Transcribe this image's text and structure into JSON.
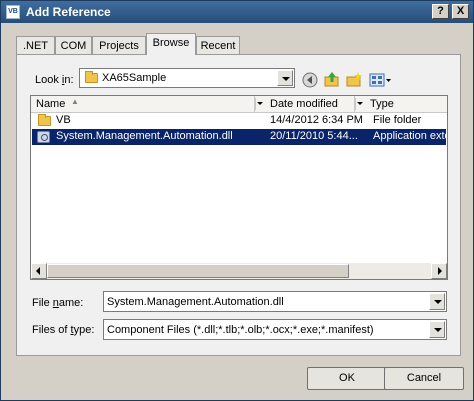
{
  "window": {
    "title": "Add Reference",
    "icon_text": "VB",
    "help_glyph": "?",
    "close_glyph": "X"
  },
  "tabs": [
    {
      "label": ".NET",
      "active": false
    },
    {
      "label": "COM",
      "active": false
    },
    {
      "label": "Projects",
      "active": false
    },
    {
      "label": "Browse",
      "active": true
    },
    {
      "label": "Recent",
      "active": false
    }
  ],
  "look_in": {
    "label_prefix": "Look ",
    "label_mnemonic": "i",
    "label_suffix": "n:",
    "value": "XA65Sample"
  },
  "toolbar_icons": [
    "back-arrow-icon",
    "up-folder-icon",
    "new-folder-icon",
    "views-menu-icon"
  ],
  "columns": {
    "name": "Name",
    "date": "Date modified",
    "type": "Type"
  },
  "files": [
    {
      "name": "VB",
      "date": "14/4/2012 6:34 PM",
      "type": "File folder",
      "kind": "folder",
      "selected": false
    },
    {
      "name": "System.Management.Automation.dll",
      "date": "20/11/2010 5:44...",
      "type": "Application exte",
      "kind": "dll",
      "selected": true
    }
  ],
  "file_name": {
    "label_prefix": "File ",
    "label_mnemonic": "n",
    "label_suffix": "ame:",
    "value": "System.Management.Automation.dll"
  },
  "file_type": {
    "label_prefix": "Files of ",
    "label_mnemonic": "t",
    "label_suffix": "ype:",
    "value": "Component Files (*.dll;*.tlb;*.olb;*.ocx;*.exe;*.manifest)"
  },
  "buttons": {
    "ok": "OK",
    "cancel": "Cancel"
  },
  "colors": {
    "titlebar": "#2f5b89",
    "selection": "#0a246a",
    "folder": "#f0c54f",
    "dialog_bg": "#d4d0c8"
  }
}
